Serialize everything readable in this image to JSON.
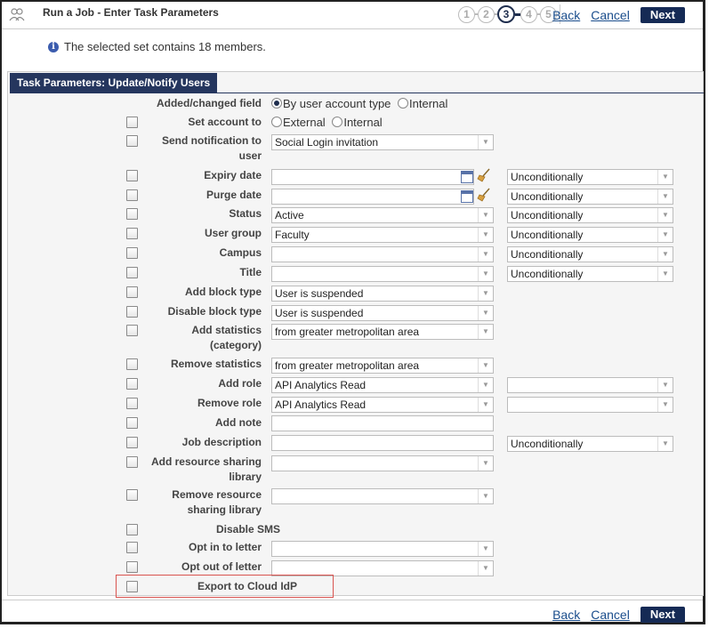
{
  "header": {
    "title": "Run a Job - Enter Task Parameters",
    "app_icon": "people-icon",
    "steps": [
      "1",
      "2",
      "3",
      "4",
      "5"
    ],
    "active_step": 3,
    "back_label": "Back",
    "cancel_label": "Cancel",
    "next_label": "Next"
  },
  "info": {
    "icon": "info-icon",
    "message": "The selected set contains 18 members."
  },
  "panel": {
    "title": "Task Parameters: Update/Notify Users"
  },
  "fields": {
    "added_changed": {
      "label": "Added/changed field",
      "options": [
        "By user account type",
        "Internal"
      ],
      "selected": "By user account type"
    },
    "set_account": {
      "label": "Set account to",
      "options": [
        "External",
        "Internal"
      ],
      "selected": ""
    },
    "send_notification": {
      "label_1": "Send notification to",
      "label_2": "user",
      "value": "Social Login invitation"
    },
    "expiry_date": {
      "label": "Expiry date",
      "value": "",
      "condition": "Unconditionally"
    },
    "purge_date": {
      "label": "Purge date",
      "value": "",
      "condition": "Unconditionally"
    },
    "status": {
      "label": "Status",
      "value": "Active",
      "condition": "Unconditionally"
    },
    "user_group": {
      "label": "User group",
      "value": "Faculty",
      "condition": "Unconditionally"
    },
    "campus": {
      "label": "Campus",
      "value": "",
      "condition": "Unconditionally"
    },
    "title": {
      "label": "Title",
      "value": "",
      "condition": "Unconditionally"
    },
    "add_block_type": {
      "label": "Add block type",
      "value": "User is suspended"
    },
    "disable_block_type": {
      "label": "Disable block type",
      "value": "User is suspended"
    },
    "add_statistics": {
      "label_1": "Add statistics",
      "label_2": "(category)",
      "value": "from greater metropolitan area"
    },
    "remove_statistics": {
      "label": "Remove statistics",
      "value": "from greater metropolitan area"
    },
    "add_role": {
      "label": "Add role",
      "value": "API Analytics Read",
      "scope": ""
    },
    "remove_role": {
      "label": "Remove role",
      "value": "API Analytics Read",
      "scope": ""
    },
    "add_note": {
      "label": "Add note",
      "value": ""
    },
    "job_description": {
      "label": "Job description",
      "value": "",
      "condition": "Unconditionally"
    },
    "add_resource_sharing": {
      "label_1": "Add resource sharing",
      "label_2": "library",
      "value": ""
    },
    "remove_resource_sharing": {
      "label_1": "Remove resource",
      "label_2": "sharing library",
      "value": ""
    },
    "disable_sms": {
      "label": "Disable SMS"
    },
    "opt_in_letter": {
      "label": "Opt in to letter",
      "value": ""
    },
    "opt_out_letter": {
      "label": "Opt out of letter",
      "value": ""
    },
    "export_cloud_idp": {
      "label": "Export to Cloud IdP"
    }
  },
  "footer": {
    "back_label": "Back",
    "cancel_label": "Cancel",
    "next_label": "Next"
  },
  "colors": {
    "primary": "#152a55",
    "link": "#1a4d8c",
    "highlight": "#d9534f"
  }
}
